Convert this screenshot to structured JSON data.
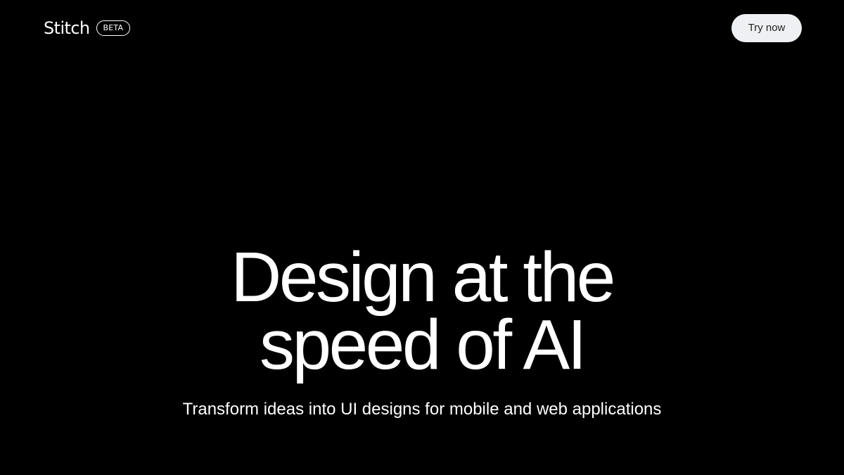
{
  "header": {
    "logo_text": "Stitch",
    "badge": "BETA",
    "cta_label": "Try now"
  },
  "hero": {
    "title_line1": "Design at the",
    "title_line2": "speed of AI",
    "subtitle": "Transform ideas into UI designs for mobile and web applications"
  },
  "colors": {
    "background": "#000000",
    "text": "#ffffff",
    "cta_background": "#eef0f3",
    "cta_text": "#1f1f1f"
  }
}
